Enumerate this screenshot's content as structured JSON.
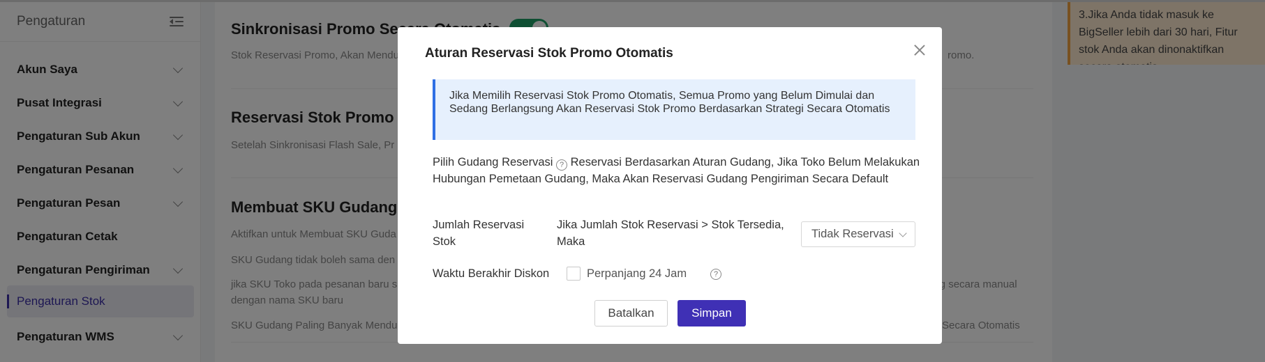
{
  "sidebar": {
    "title": "Pengaturan",
    "collapse_icon": "menu-collapse-icon",
    "items": [
      {
        "label": "Akun Saya",
        "has_children": true
      },
      {
        "label": "Pusat Integrasi",
        "has_children": true
      },
      {
        "label": "Pengaturan Sub Akun",
        "has_children": true
      },
      {
        "label": "Pengaturan Pesanan",
        "has_children": true
      },
      {
        "label": "Pengaturan Pesan",
        "has_children": true
      },
      {
        "label": "Pengaturan Cetak",
        "has_children": false
      },
      {
        "label": "Pengaturan Pengiriman",
        "has_children": true
      },
      {
        "label": "Pengaturan Stok",
        "active": true
      },
      {
        "label": "Pengaturan WMS",
        "has_children": true
      }
    ]
  },
  "main": {
    "sections": [
      {
        "title": "Sinkronisasi Promo Secara Otomatis",
        "lines": [
          "Stok Reservasi Promo, Akan Mendu",
          "romo."
        ]
      },
      {
        "title": "Reservasi Stok Promo Ot",
        "lines": [
          "Setelah Sinkronisasi Flash Sale, Pr"
        ]
      },
      {
        "title": "Membuat SKU Gudang S",
        "lines": [
          "Aktifkan untuk Membuat SKU Guda",
          "SKU Gudang tidak boleh sama den",
          "jika SKU Toko pada pesanan baru s",
          "ang secara manual",
          "dengan nama SKU baru",
          "SKU Gudang Paling Banyak Mendu",
          "Secara Otomatis"
        ]
      }
    ],
    "toggle_on": true
  },
  "note": {
    "text": "3.Jika Anda tidak masuk ke BigSeller lebih dari 30 hari, Fitur stok Anda akan dinonaktifkan secara otomatis"
  },
  "modal": {
    "title": "Aturan Reservasi Stok Promo Otomatis",
    "close_icon": "close-icon",
    "info": "Jika Memilih Reservasi Stok Promo Otomatis, Semua Promo yang Belum Dimulai dan Sedang Berlangsung Akan Reservasi Stok Promo Berdasarkan Strategi Secara Otomatis",
    "warehouse_label": "Pilih Gudang Reservasi",
    "warehouse_desc": "Reservasi Berdasarkan Aturan Gudang, Jika Toko Belum Melakukan Hubungan Pemetaan Gudang, Maka Akan Reservasi Gudang Pengiriman Secara Default",
    "qty_label": "Jumlah Reservasi Stok",
    "qty_condition": "Jika Jumlah Stok Reservasi > Stok Tersedia, Maka",
    "qty_select_value": "Tidak Reservasi",
    "discount_label": "Waktu Berakhir Diskon",
    "extend_label": "Perpanjang 24 Jam",
    "extend_checked": false,
    "help_glyph": "?",
    "cancel_label": "Batalkan",
    "save_label": "Simpan",
    "accent_color": "#3f30b5"
  }
}
